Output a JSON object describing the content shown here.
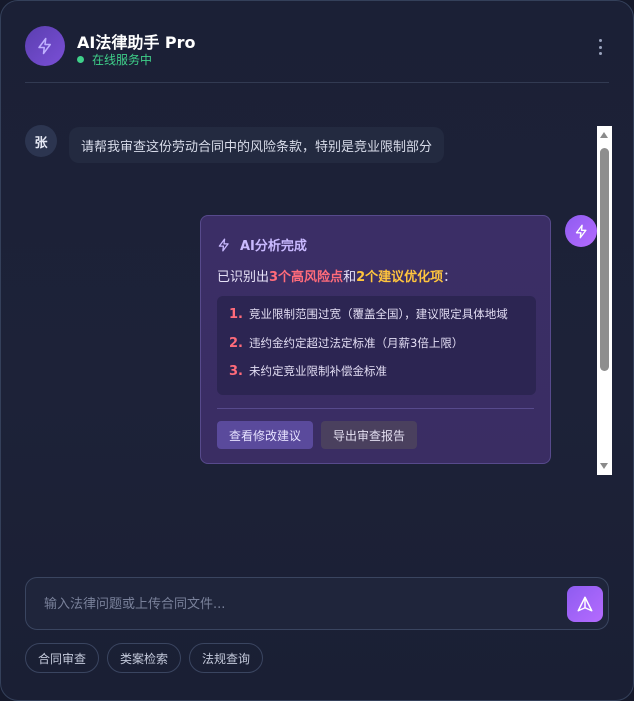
{
  "header": {
    "title": "AI法律助手 Pro",
    "status": "在线服务中",
    "logo_icon": "bolt-icon",
    "more_icon": "more-vertical-icon"
  },
  "messages": {
    "user": {
      "avatar_text": "张",
      "text": "请帮我审查这份劳动合同中的风险条款，特别是竞业限制部分"
    },
    "ai": {
      "heading": "AI分析完成",
      "summary_prefix": "已识别出",
      "summary_high": "3个高风险点",
      "summary_and": "和",
      "summary_suggest": "2个建议优化项",
      "summary_suffix": "：",
      "issues": [
        {
          "num": "1.",
          "text": "竞业限制范围过宽（覆盖全国），建议限定具体地域"
        },
        {
          "num": "2.",
          "text": "违约金约定超过法定标准（月薪3倍上限）"
        },
        {
          "num": "3.",
          "text": "未约定竞业限制补偿金标准"
        }
      ],
      "primary_button": "查看修改建议",
      "secondary_button": "导出审查报告",
      "avatar_icon": "bolt-icon"
    }
  },
  "input": {
    "placeholder": "输入法律问题或上传合同文件...",
    "value": "",
    "send_icon": "send-icon"
  },
  "quick_actions": [
    "合同审查",
    "类案检索",
    "法规查询"
  ],
  "colors": {
    "accent": "#8e5cf0",
    "status_green": "#3fd08a",
    "risk_red": "#ff6b7a",
    "suggest_yellow": "#ffc53d"
  }
}
